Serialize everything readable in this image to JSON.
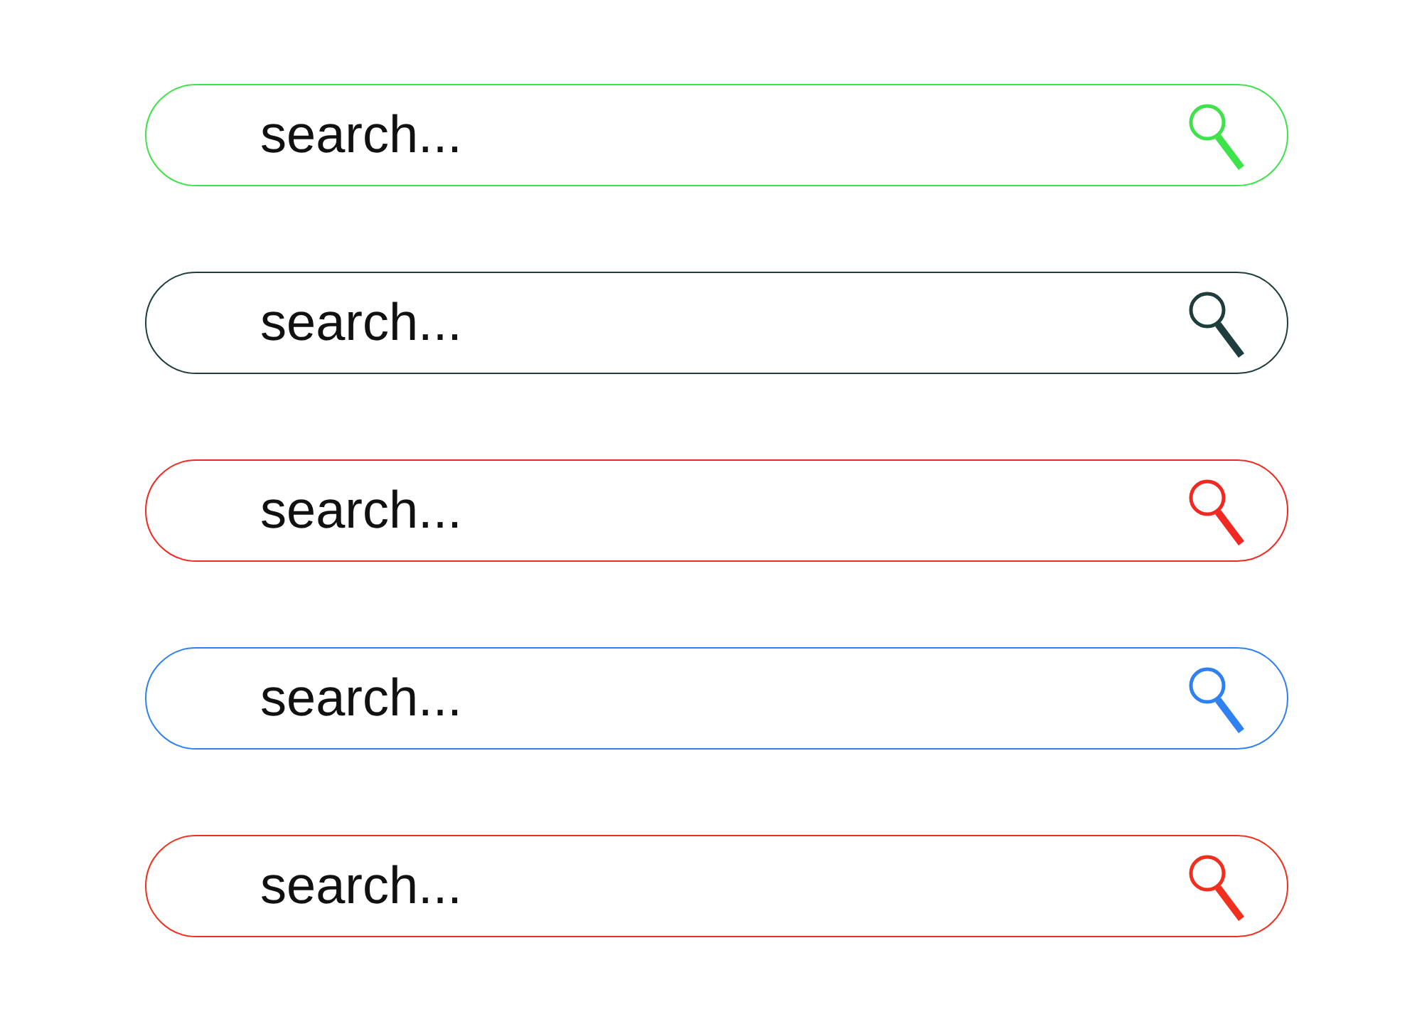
{
  "search_bars": [
    {
      "placeholder": "search...",
      "color": "#3ee24a"
    },
    {
      "placeholder": "search...",
      "color": "#1f3d3d"
    },
    {
      "placeholder": "search...",
      "color": "#f02a22"
    },
    {
      "placeholder": "search...",
      "color": "#2f80f0"
    },
    {
      "placeholder": "search...",
      "color": "#f0301e"
    }
  ]
}
